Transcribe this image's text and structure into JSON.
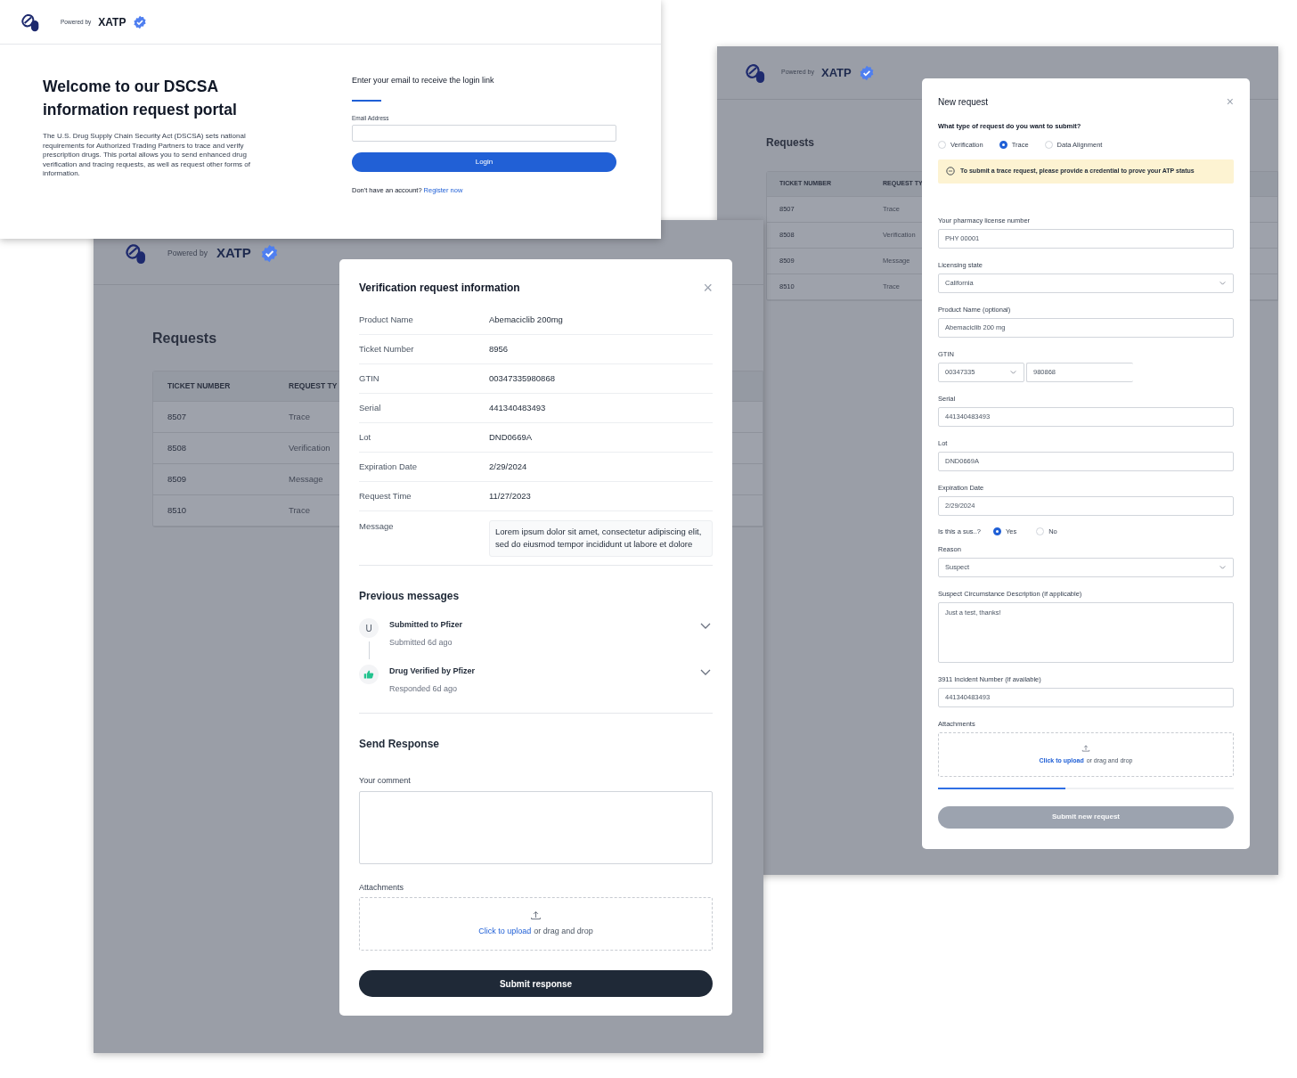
{
  "requests_page_back": {
    "brand": {
      "powered_by": "Powered by",
      "name": "XATP"
    },
    "title": "Requests",
    "table": {
      "columns": [
        "TICKET NUMBER",
        "REQUEST TY"
      ],
      "rows": [
        [
          "8507",
          "Trace"
        ],
        [
          "8508",
          "Verification"
        ],
        [
          "8509",
          "Message"
        ],
        [
          "8510",
          "Trace"
        ]
      ]
    },
    "new_request_modal": {
      "title": "New request",
      "close": "×",
      "question": "What type of request do you want to submit?",
      "request_types": [
        {
          "label": "Verification",
          "selected": false
        },
        {
          "label": "Trace",
          "selected": true
        },
        {
          "label": "Data Alignment",
          "selected": false
        }
      ],
      "notice": "To submit a trace request, please provide a credential to prove your ATP status",
      "fields": [
        {
          "kind": "text",
          "label": "Your pharmacy license number",
          "value": "PHY 00001"
        },
        {
          "kind": "select",
          "label": "Licensing state",
          "value": "California"
        },
        {
          "kind": "text",
          "label": "Product Name (optional)",
          "value": "Abemaciclib 200 mg"
        },
        {
          "kind": "gtin",
          "label": "GTIN",
          "prefix": "00347335",
          "value": "980868"
        },
        {
          "kind": "text",
          "label": "Serial",
          "value": "441340483493"
        },
        {
          "kind": "text",
          "label": "Lot",
          "value": "DND0669A"
        },
        {
          "kind": "text",
          "label": "Expiration Date",
          "value": "2/29/2024"
        },
        {
          "kind": "radio",
          "label": "Is this a sus..?",
          "options": [
            {
              "label": "Yes",
              "selected": true
            },
            {
              "label": "No",
              "selected": false
            }
          ]
        },
        {
          "kind": "select",
          "label": "Reason",
          "value": "Suspect"
        },
        {
          "kind": "textarea",
          "label": "Suspect Circumstance Description (if applicable)",
          "value": "Just a test, thanks!"
        },
        {
          "kind": "text",
          "label": "3911 Incident Number (if available)",
          "value": "441340483493"
        },
        {
          "kind": "upload",
          "label": "Attachments",
          "link": "Click to upload",
          "rest": "or drag and drop"
        }
      ],
      "progress": {
        "level": 0.43
      },
      "submit": {
        "label": "Submit new request",
        "disabled": true
      }
    }
  },
  "requests_page_front": {
    "brand": {
      "powered_by": "Powered by",
      "name": "XATP"
    },
    "title": "Requests",
    "table": {
      "columns": [
        "TICKET NUMBER",
        "REQUEST TY"
      ],
      "rows": [
        [
          "8507",
          "Trace"
        ],
        [
          "8508",
          "Verification"
        ],
        [
          "8509",
          "Message"
        ],
        [
          "8510",
          "Trace"
        ]
      ]
    },
    "verification_modal": {
      "title": "Verification request information",
      "close": "×",
      "details": [
        {
          "label": "Product Name",
          "value": "Abemaciclib 200mg"
        },
        {
          "label": "Ticket Number",
          "value": "8956"
        },
        {
          "label": "GTIN",
          "value": "00347335980868"
        },
        {
          "label": "Serial",
          "value": "441340483493"
        },
        {
          "label": "Lot",
          "value": "DND0669A"
        },
        {
          "label": "Expiration Date",
          "value": "2/29/2024"
        },
        {
          "label": "Request Time",
          "value": "11/27/2023"
        }
      ],
      "message": {
        "label": "Message",
        "value": "Lorem ipsum dolor sit amet, consectetur adipiscing elit, sed do eiusmod tempor incididunt ut labore et dolore"
      },
      "previous_messages": {
        "title": "Previous messages",
        "items": [
          {
            "kind": "initial",
            "initial": "U",
            "title": "Submitted to Pfizer",
            "subtitle": "Submitted 6d ago"
          },
          {
            "kind": "approved",
            "title": "Drug Verified by Pfizer",
            "subtitle": "Responded 6d ago"
          }
        ]
      },
      "response": {
        "title": "Send Response",
        "comment_label": "Your comment",
        "attachments_label": "Attachments",
        "upload_link": "Click to upload",
        "upload_rest": "or drag and drop",
        "submit": "Submit response"
      }
    }
  },
  "login_page": {
    "brand": {
      "powered_by": "Powered by",
      "name": "XATP"
    },
    "heading": "Welcome to our DSCSA information request portal",
    "description": "The U.S. Drug Supply Chain Security Act (DSCSA) sets national requirements for Authorized Trading Partners to trace and verify prescription drugs. This portal allows you to send enhanced drug verification and tracing requests, as well as request other forms of information.",
    "form_title": "Enter your email to receive the login link",
    "email_label": "Email Address",
    "login_button": "Login",
    "signup_prompt": "Don't have an account?",
    "signup_link": "Register now"
  }
}
